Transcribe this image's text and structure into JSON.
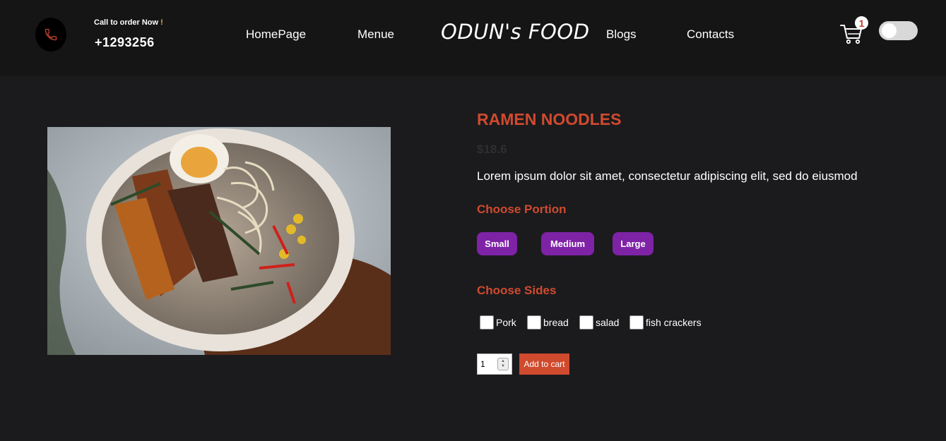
{
  "header": {
    "call_label": "Call to order Now",
    "call_bang": "!",
    "phone": "+1293256",
    "nav": [
      "HomePage",
      "Menue",
      "Blogs",
      "Contacts"
    ],
    "logo": "ODUN's FOOD",
    "cart_count": "1",
    "dark_mode_toggle": false
  },
  "product": {
    "title": "RAMEN NOODLES",
    "price": "$18.6",
    "description": "Lorem ipsum dolor sit amet, consectetur adipiscing elit, sed do eiusmod",
    "portion_label": "Choose Portion",
    "portions": [
      "Small",
      "Medium",
      "Large"
    ],
    "sides_label": "Choose Sides",
    "sides": [
      "Pork",
      "bread",
      "salad",
      "fish crackers"
    ],
    "quantity": "1",
    "add_to_cart": "Add to cart"
  },
  "colors": {
    "accent": "#d04a2e",
    "portion_button": "#7e22a6",
    "background": "#1b1b1d",
    "navbar": "#151515"
  },
  "icons": [
    "phone-icon",
    "cart-icon"
  ]
}
